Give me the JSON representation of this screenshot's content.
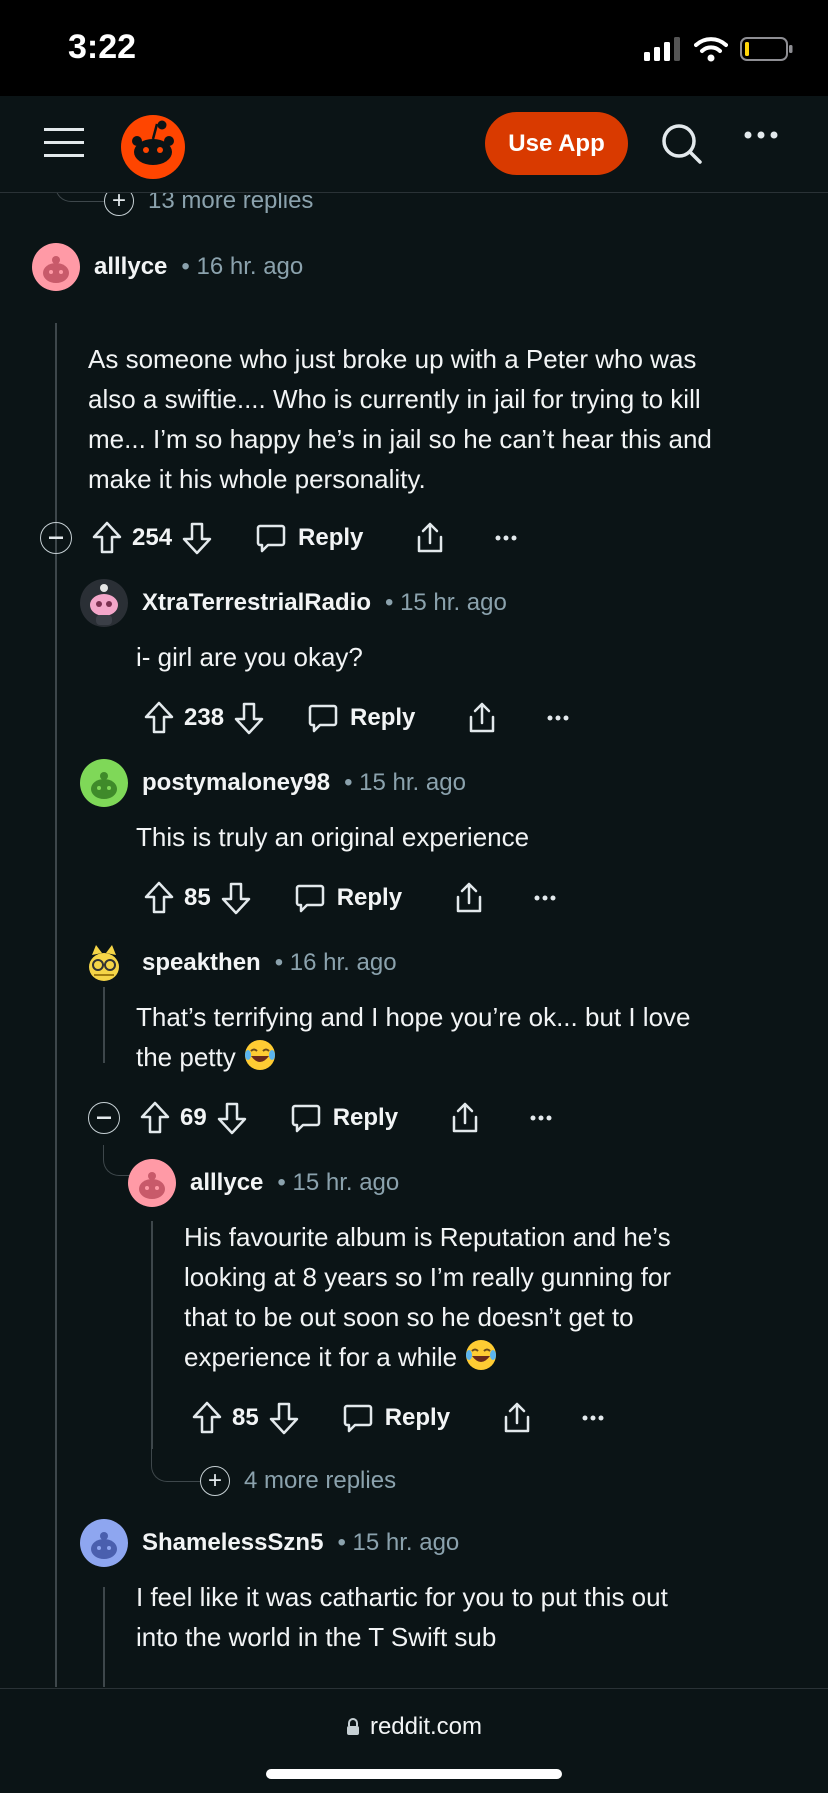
{
  "status_bar": {
    "time": "3:22"
  },
  "navbar": {
    "use_app_label": "Use App"
  },
  "top_more_replies": "13 more replies",
  "comments": [
    {
      "user": "alllyce",
      "time": "16 hr. ago",
      "lines": [
        "As someone who just broke up with a Peter who was",
        "also a swiftie.... Who is currently in jail for trying to kill",
        "me... I’m so happy he’s in jail so he can’t hear this and",
        "make it his whole personality."
      ],
      "score": "254",
      "reply": "Reply",
      "avatar_color": "#ff9aa6"
    },
    {
      "user": "XtraTerrestrialRadio",
      "time": "15 hr. ago",
      "lines": [
        "i- girl are you okay?"
      ],
      "score": "238",
      "reply": "Reply",
      "avatar_color": "#2a2f35"
    },
    {
      "user": "postymaloney98",
      "time": "15 hr. ago",
      "lines": [
        "This is truly an original experience"
      ],
      "score": "85",
      "reply": "Reply",
      "avatar_color": "#7fd858"
    },
    {
      "user": "speakthen",
      "time": "16 hr. ago",
      "lines": [
        "That’s terrifying and I hope you’re ok... but I love",
        "the petty"
      ],
      "score": "69",
      "reply": "Reply",
      "avatar_color": "#f5d547"
    },
    {
      "user": "alllyce",
      "time": "15 hr. ago",
      "lines": [
        "His favourite album is Reputation and he’s",
        "looking at 8 years so I’m really gunning for",
        "that to be out soon so he doesn’t get to",
        "experience it for a while"
      ],
      "score": "85",
      "reply": "Reply",
      "avatar_color": "#ff9aa6"
    },
    {
      "user": "ShamelessSzn5",
      "time": "15 hr. ago",
      "lines": [
        "I feel like it was cathartic for you to put this out",
        "into the world in the T Swift sub"
      ],
      "avatar_color": "#8ea6f0"
    }
  ],
  "nested_more_replies": "4 more replies",
  "bottom_bar": {
    "url": "reddit.com"
  },
  "icons": {
    "upvote": "arrow-up-icon",
    "downvote": "arrow-down-icon",
    "reply": "speech-bubble-icon",
    "share": "share-icon",
    "more": "ellipsis-icon",
    "collapse": "minus-circle-icon",
    "expand": "plus-circle-icon",
    "emoji": "laughing-tears-emoji"
  },
  "colors": {
    "accent": "#d93a00",
    "background": "#0b1416",
    "meta_text": "#8ba2ad"
  }
}
